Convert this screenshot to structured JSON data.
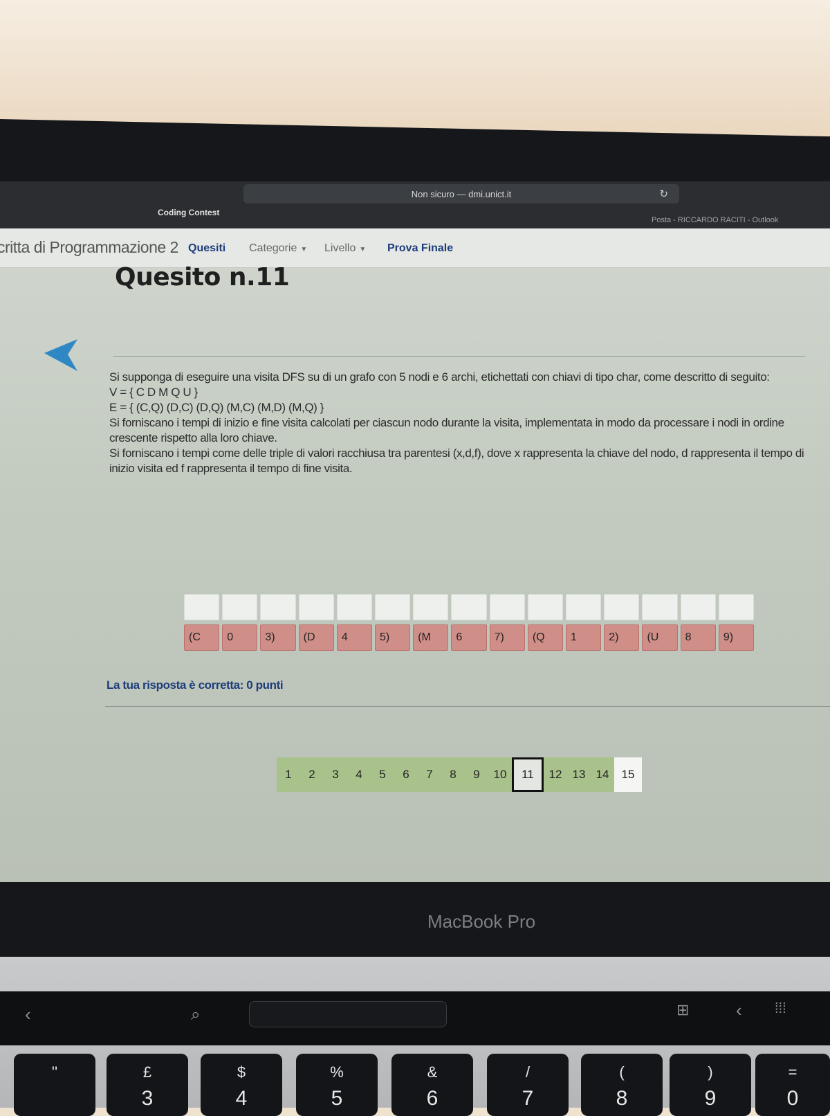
{
  "browser": {
    "address": "Non sicuro — dmi.unict.it",
    "tab_left": "Coding Contest",
    "tab_right": "Posta - RICCARDO RACITI - Outlook"
  },
  "site": {
    "title": "critta di Programmazione 2",
    "nav": {
      "quesiti": "Quesiti",
      "categorie": "Categorie",
      "livello": "Livello",
      "prova_finale": "Prova Finale"
    }
  },
  "question": {
    "heading": "Quesito n.11",
    "intro": "Si supponga di eseguire una visita DFS su di un grafo con 5 nodi e 6 archi, etichettati con chiavi di tipo char, come descritto di seguito:",
    "vertices": "V = { C D M Q U }",
    "edges": "E = { (C,Q) (D,C) (D,Q) (M,C) (M,D) (M,Q) }",
    "para1": "Si forniscano i tempi di inizio e fine visita calcolati per ciascun nodo durante la visita, implementata in modo da processare i nodi in ordine crescente rispetto alla loro chiave.",
    "para2": "Si forniscano i tempi come delle triple di valori racchiusa tra parentesi (x,d,f), dove x rappresenta la chiave del nodo, d rappresenta il tempo di inizio visita ed f rappresenta il tempo di fine visita."
  },
  "answer": {
    "cells": [
      "(C",
      "0",
      "3)",
      "(D",
      "4",
      "5)",
      "(M",
      "6",
      "7)",
      "(Q",
      "1",
      "2)",
      "(U",
      "8",
      "9)"
    ],
    "score": "La tua risposta è corretta: 0 punti"
  },
  "pager": {
    "pages": [
      "1",
      "2",
      "3",
      "4",
      "5",
      "6",
      "7",
      "8",
      "9",
      "10",
      "11",
      "12",
      "13",
      "14",
      "15"
    ],
    "current": "11"
  },
  "device": {
    "brand": "MacBook Pro",
    "keys": [
      {
        "top": "''",
        "bot": ""
      },
      {
        "top": "£",
        "bot": "3"
      },
      {
        "top": "$",
        "bot": "4"
      },
      {
        "top": "%",
        "bot": "5"
      },
      {
        "top": "&",
        "bot": "6"
      },
      {
        "top": "/",
        "bot": "7"
      },
      {
        "top": "(",
        "bot": "8"
      },
      {
        "top": ")",
        "bot": "9"
      },
      {
        "top": "=",
        "bot": "0"
      }
    ]
  },
  "colors": {
    "answer_cell": "#cf8e87",
    "pager_cell": "#a9c28b",
    "nav_link": "#1d3d7a",
    "back_arrow": "#2f87c4"
  }
}
